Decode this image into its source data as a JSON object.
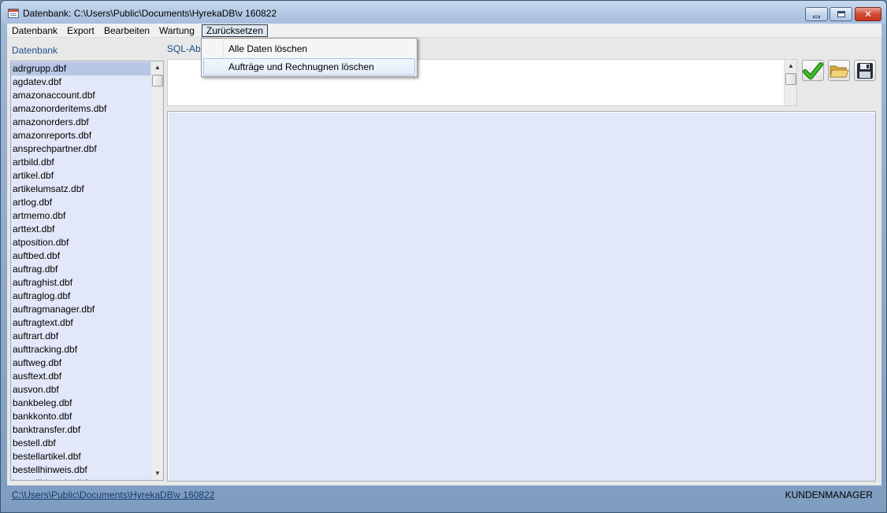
{
  "window": {
    "title": "Datenbank: C:\\Users\\Public\\Documents\\HyrekaDB\\v 160822",
    "minimize_icon": "minimize-icon",
    "maximize_icon": "maximize-icon",
    "close_icon": "close-icon",
    "close_glyph": "✕"
  },
  "menu": {
    "items": [
      "Datenbank",
      "Export",
      "Bearbeiten",
      "Wartung",
      "Zurücksetzen"
    ],
    "open_index": 4
  },
  "dropdown": {
    "items": [
      "Alle Daten löschen",
      "Aufträge und Rechnugnen löschen"
    ],
    "hover_index": 1
  },
  "left_panel": {
    "label": "Datenbank",
    "selected_index": 0,
    "items": [
      "adrgrupp.dbf",
      "agdatev.dbf",
      "amazonaccount.dbf",
      "amazonorderitems.dbf",
      "amazonorders.dbf",
      "amazonreports.dbf",
      "ansprechpartner.dbf",
      "artbild.dbf",
      "artikel.dbf",
      "artikelumsatz.dbf",
      "artlog.dbf",
      "artmemo.dbf",
      "arttext.dbf",
      "atposition.dbf",
      "auftbed.dbf",
      "auftrag.dbf",
      "auftraghist.dbf",
      "auftraglog.dbf",
      "auftragmanager.dbf",
      "auftragtext.dbf",
      "auftrart.dbf",
      "aufttracking.dbf",
      "auftweg.dbf",
      "ausftext.dbf",
      "ausvon.dbf",
      "bankbeleg.dbf",
      "bankkonto.dbf",
      "banktransfer.dbf",
      "bestell.dbf",
      "bestellartikel.dbf",
      "bestellhinweis.dbf",
      "bestellhinweis.dbf"
    ]
  },
  "sql": {
    "label": "SQL-Ab"
  },
  "toolbar": {
    "execute_icon": "checkmark-icon",
    "open_icon": "folder-icon",
    "save_icon": "save-icon",
    "colors": {
      "check": "#2e9b1a",
      "folder": "#e9c25a",
      "disk": "#2a2f36"
    }
  },
  "status": {
    "path": "C:\\Users\\Public\\Documents\\HyrekaDB\\v 160822",
    "right": "KUNDENMANAGER"
  }
}
